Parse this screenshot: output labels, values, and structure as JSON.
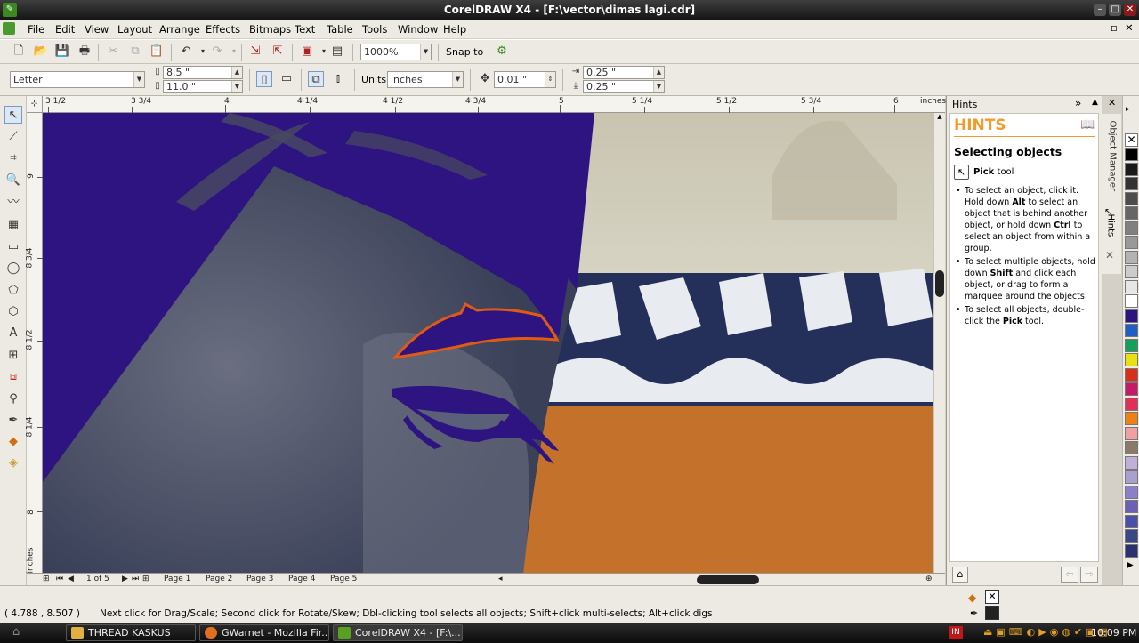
{
  "window": {
    "title": "CorelDRAW X4 - [F:\\vector\\dimas lagi.cdr]"
  },
  "menu": [
    "File",
    "Edit",
    "View",
    "Layout",
    "Arrange",
    "Effects",
    "Bitmaps",
    "Text",
    "Table",
    "Tools",
    "Window",
    "Help"
  ],
  "toolbar": {
    "zoom": "1000%",
    "snap_label": "Snap to"
  },
  "propbar": {
    "paper_size": "Letter",
    "width": "8.5 \"",
    "height": "11.0 \"",
    "units_label": "Units:",
    "units": "inches",
    "nudge": "0.01 \"",
    "dup_x": "0.25 \"",
    "dup_y": "0.25 \""
  },
  "ruler": {
    "units": "inches",
    "h_labels": [
      "3 1/2",
      "3 3/4",
      "4",
      "4 1/4",
      "4 1/2",
      "4 3/4",
      "5",
      "5 1/4",
      "5 1/2",
      "5 3/4",
      "6"
    ],
    "v_labels": [
      "9",
      "8 3/4",
      "8 1/2",
      "8 1/4",
      "8"
    ],
    "v_units": "inches"
  },
  "pages": {
    "counter": "1 of 5",
    "tabs": [
      "Page 1",
      "Page 2",
      "Page 3",
      "Page 4",
      "Page 5"
    ]
  },
  "hints": {
    "docker_title": "Hints",
    "header": "HINTS",
    "section": "Selecting objects",
    "tool_bold": "Pick",
    "tool_rest": " tool",
    "bullets": [
      [
        {
          "t": "To select an object, click it. Hold down "
        },
        {
          "t": "Alt",
          "b": true
        },
        {
          "t": " to select an object that is behind another object, or hold down "
        },
        {
          "t": "Ctrl",
          "b": true
        },
        {
          "t": " to select an object from within a group."
        }
      ],
      [
        {
          "t": "To select multiple objects, hold down "
        },
        {
          "t": "Shift",
          "b": true
        },
        {
          "t": " and click each object, or drag to form a marquee around the objects."
        }
      ],
      [
        {
          "t": "To select all objects, double-click the "
        },
        {
          "t": "Pick",
          "b": true
        },
        {
          "t": " tool."
        }
      ]
    ],
    "side_tabs": [
      "Object Manager",
      "Hints"
    ]
  },
  "palette": [
    "#000000",
    "#1a1a1a",
    "#333333",
    "#4d4d4d",
    "#666666",
    "#808080",
    "#999999",
    "#b3b3b3",
    "#cccccc",
    "#e6e6e6",
    "#ffffff",
    "#2e1480",
    "#1d5fc4",
    "#14a05a",
    "#e8e010",
    "#d83018",
    "#c8186a",
    "#e0305a",
    "#f08010",
    "#f0a0a0",
    "#8a7a6a",
    "#c0b0d8",
    "#a8a0d0",
    "#8a80c8",
    "#6a60b8",
    "#4a50a8",
    "#3a4888",
    "#2a3070"
  ],
  "status": {
    "coords": "( 4.788 , 8.507 )",
    "message": "Next click for Drag/Scale; Second click for Rotate/Skew; Dbl-clicking tool selects all objects; Shift+click multi-selects; Alt+click digs"
  },
  "taskbar": {
    "items": [
      {
        "label": "THREAD KASKUS",
        "icon": "#e0b040"
      },
      {
        "label": "GWarnet - Mozilla Fir...",
        "icon": "#e07020"
      },
      {
        "label": "CorelDRAW X4 - [F:\\...",
        "icon": "#5aa020"
      }
    ],
    "lang": "IN",
    "clock": "10:09 PM"
  },
  "colors": {
    "shape_fill": "#2e1480",
    "outline": "#e05a14",
    "hints_orange": "#f39a2a"
  }
}
